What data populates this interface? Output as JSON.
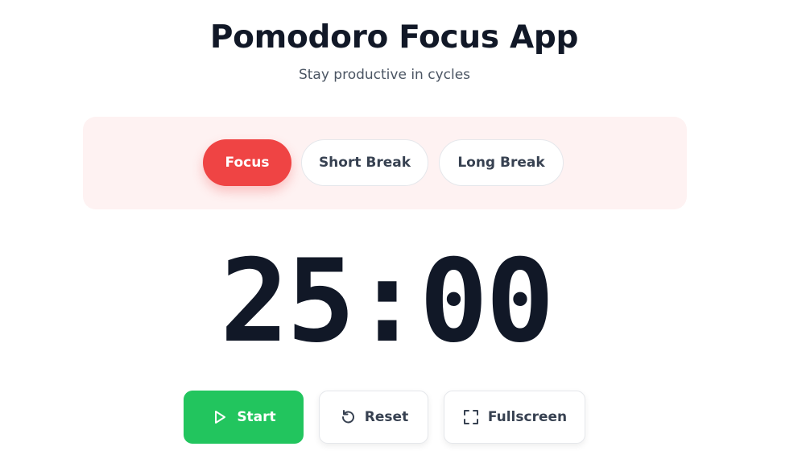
{
  "header": {
    "title": "Pomodoro Focus App",
    "subtitle": "Stay productive in cycles"
  },
  "modes": {
    "items": [
      {
        "label": "Focus",
        "active": true
      },
      {
        "label": "Short Break",
        "active": false
      },
      {
        "label": "Long Break",
        "active": false
      }
    ]
  },
  "timer": {
    "display": "25:00"
  },
  "controls": {
    "start_label": "Start",
    "reset_label": "Reset",
    "fullscreen_label": "Fullscreen",
    "start_icon": "play-icon",
    "reset_icon": "reset-icon",
    "fullscreen_icon": "fullscreen-icon"
  },
  "colors": {
    "accent_focus": "#ef4444",
    "panel_background": "#fef2f2",
    "start_button": "#22c55e",
    "text_primary": "#111827",
    "text_secondary": "#4b5563"
  }
}
